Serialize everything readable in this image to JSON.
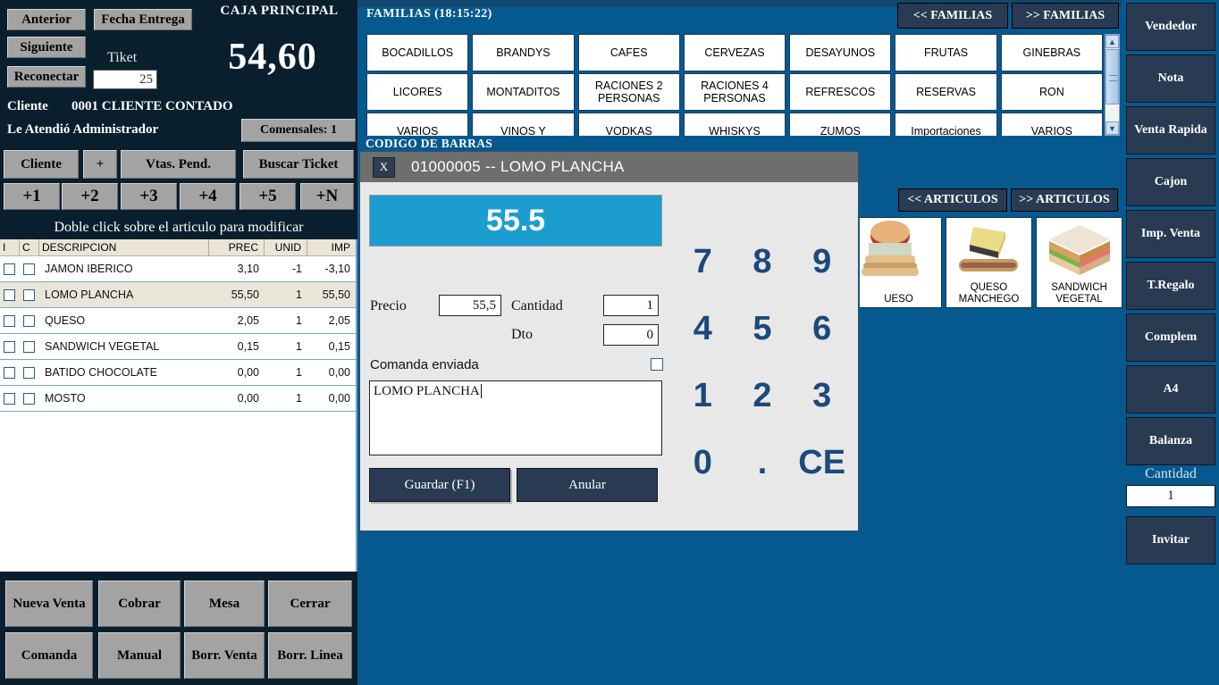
{
  "left": {
    "buttons": {
      "anterior": "Anterior",
      "fecha_entrega": "Fecha Entrega",
      "siguiente": "Siguiente",
      "reconectar": "Reconectar"
    },
    "tiket_label": "Tiket",
    "tiket_value": "25",
    "caja_title": "CAJA PRINCIPAL",
    "total": "54,60",
    "cliente_label": "Cliente",
    "cliente_value": "0001 CLIENTE CONTADO",
    "atendio": "Le Atendió Administrador",
    "comensales": "Comensales: 1",
    "action_row": {
      "cliente": "Cliente",
      "plus": "+",
      "vtas_pend": "Vtas. Pend.",
      "buscar_ticket": "Buscar Ticket"
    },
    "quick_add": [
      "+1",
      "+2",
      "+3",
      "+4",
      "+5",
      "+N"
    ],
    "hint": "Doble click sobre el articulo para modificar",
    "table": {
      "headers": [
        "I",
        "C",
        "DESCRIPCION",
        "PREC",
        "UNID",
        "IMP"
      ],
      "rows": [
        {
          "desc": "JAMON IBERICO",
          "prec": "3,10",
          "unid": "-1",
          "imp": "-3,10",
          "selected": false
        },
        {
          "desc": "LOMO PLANCHA",
          "prec": "55,50",
          "unid": "1",
          "imp": "55,50",
          "selected": true
        },
        {
          "desc": "QUESO",
          "prec": "2,05",
          "unid": "1",
          "imp": "2,05",
          "selected": false
        },
        {
          "desc": "SANDWICH VEGETAL",
          "prec": "0,15",
          "unid": "1",
          "imp": "0,15",
          "selected": false
        },
        {
          "desc": "BATIDO CHOCOLATE",
          "prec": "0,00",
          "unid": "1",
          "imp": "0,00",
          "selected": false
        },
        {
          "desc": "MOSTO",
          "prec": "0,00",
          "unid": "1",
          "imp": "0,00",
          "selected": false
        }
      ]
    },
    "bottom_buttons": {
      "nueva_venta": "Nueva Venta",
      "cobrar": "Cobrar",
      "mesa": "Mesa",
      "cerrar": "Cerrar",
      "comanda": "Comanda",
      "manual": "Manual",
      "borr_venta": "Borr. Venta",
      "borr_linea": "Borr. Linea"
    }
  },
  "familias": {
    "title": "FAMILIAS (18:15:22)",
    "prev_label": "<< FAMILIAS",
    "next_label": ">> FAMILIAS",
    "items": [
      "BOCADILLOS",
      "BRANDYS",
      "CAFES",
      "CERVEZAS",
      "DESAYUNOS",
      "FRUTAS",
      "GINEBRAS",
      "LICORES",
      "MONTADITOS",
      "RACIONES 2 PERSONAS",
      "RACIONES 4 PERSONAS",
      "REFRESCOS",
      "RESERVAS",
      "RON",
      "VARIOS",
      "VINOS Y",
      "VODKAS",
      "WHISKYS",
      "ZUMOS",
      "Importaciones",
      "VARIOS"
    ],
    "scroll_up_icon": "scroll-up-icon",
    "scroll_down_icon": "scroll-down-icon"
  },
  "codigo_barras_label": "CODIGO DE BARRAS",
  "articulos": {
    "prev_label": "<< ARTICULOS",
    "next_label": ">> ARTICULOS",
    "cards": [
      {
        "label": "UESO",
        "image": "cheese-sandwich-image"
      },
      {
        "label": "QUESO MANCHEGO",
        "image": "manchego-cheese-image"
      },
      {
        "label": "SANDWICH VEGETAL",
        "image": "vegetal-sandwich-image"
      }
    ]
  },
  "modal": {
    "close_label": "X",
    "title": "01000005 -- LOMO PLANCHA",
    "display_value": "55.5",
    "precio_label": "Precio",
    "precio_value": "55,5",
    "cantidad_label": "Cantidad",
    "cantidad_value": "1",
    "dto_label": "Dto",
    "dto_value": "0",
    "comanda_label": "Comanda enviada",
    "comanda_checked": false,
    "notes_value": "LOMO PLANCHA",
    "save_label": "Guardar (F1)",
    "cancel_label": "Anular",
    "keypad": [
      "7",
      "8",
      "9",
      "4",
      "5",
      "6",
      "1",
      "2",
      "3",
      "0",
      ".",
      "CE"
    ]
  },
  "sidebar": {
    "buttons": [
      "Vendedor",
      "Nota",
      "Venta Rapida",
      "Cajon",
      "Imp. Venta",
      "T.Regalo",
      "Complem",
      "A4",
      "Balanza"
    ],
    "cantidad_label": "Cantidad",
    "cantidad_value": "1",
    "invitar": "Invitar"
  },
  "colors": {
    "bg_blue": "#06598f",
    "panel_navy": "#0a1f2e",
    "button_gray": "#a3a3a3",
    "dark_button": "#293b52",
    "display_cyan": "#1b9dd0",
    "row_highlight": "#e9e5d8",
    "keypad_text": "#1b4a7a"
  }
}
